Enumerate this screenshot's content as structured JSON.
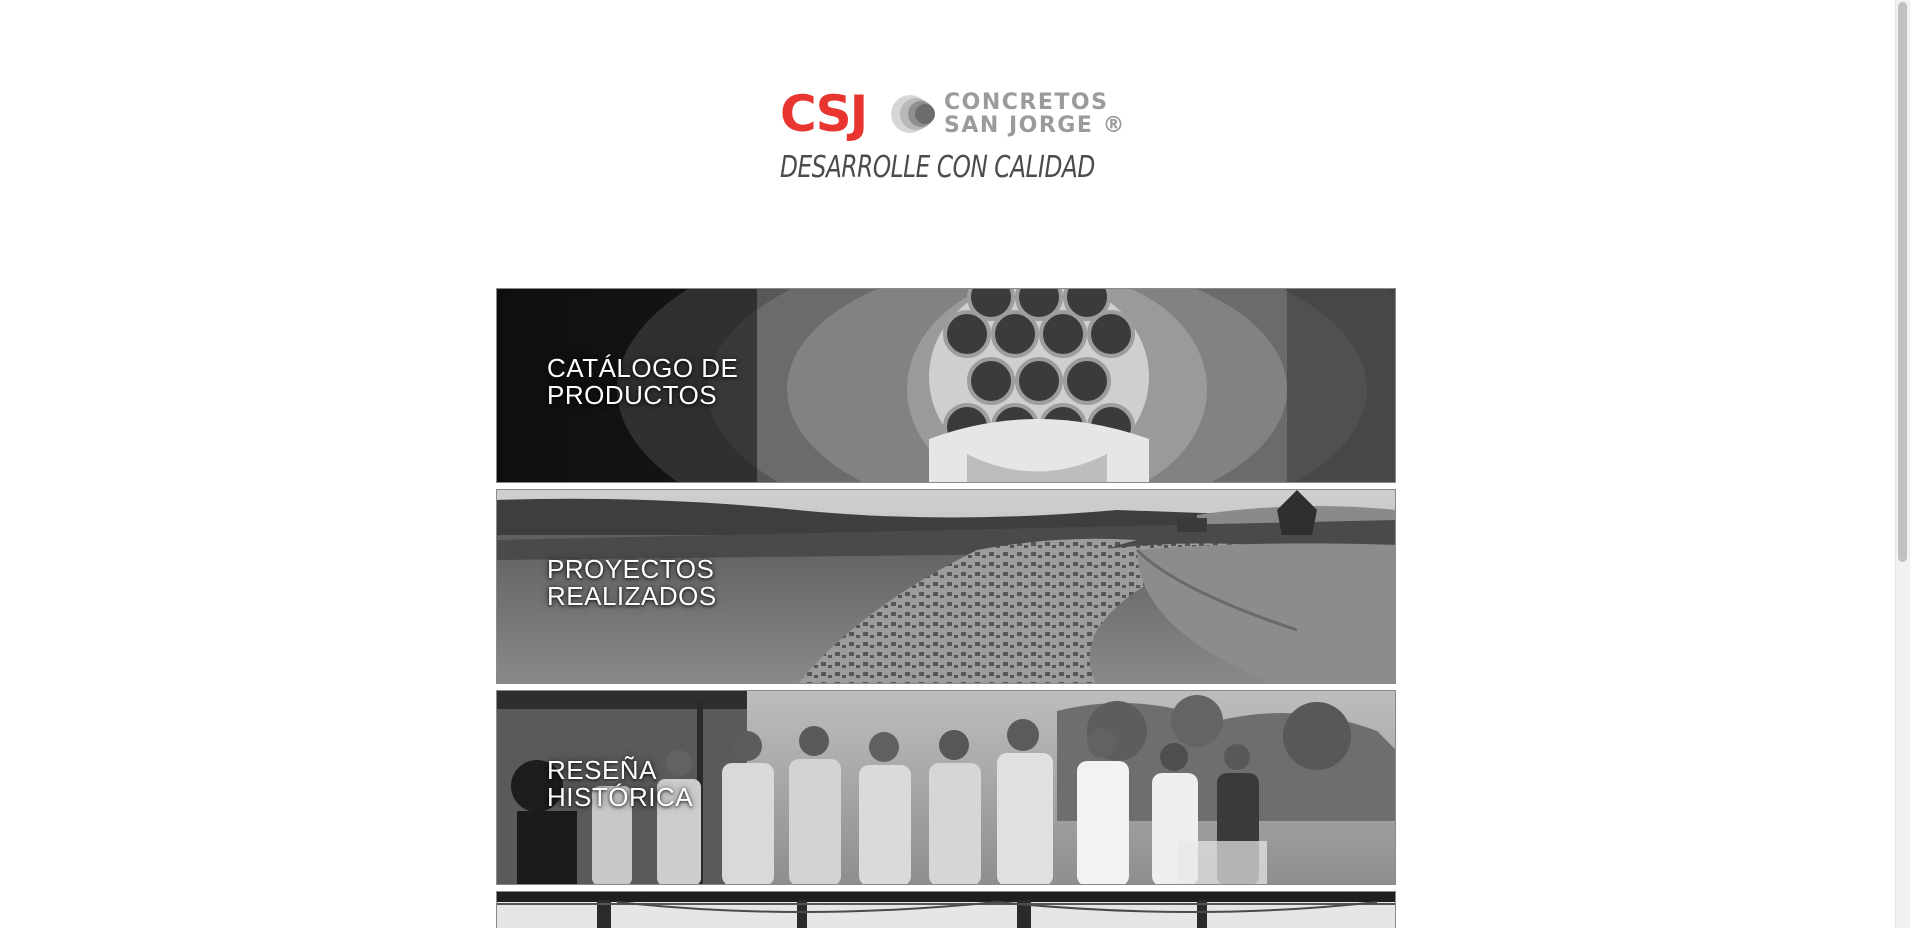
{
  "brand": {
    "logo_initials": "CSJ",
    "logo_name_line1": "CONCRETOS",
    "logo_name_line2": "SAN JORGE ®",
    "tagline": "DESARROLLE CON CALIDAD",
    "colors": {
      "accent_red": "#e8352f",
      "logo_gray": "#9b9b9b",
      "tagline_gray": "#4b4b4b"
    }
  },
  "sections": [
    {
      "title": "CATÁLOGO DE\nPRODUCTOS"
    },
    {
      "title": "PROYECTOS\nREALIZADOS"
    },
    {
      "title": "RESEÑA\nHISTÓRICA"
    },
    {
      "title": ""
    }
  ]
}
